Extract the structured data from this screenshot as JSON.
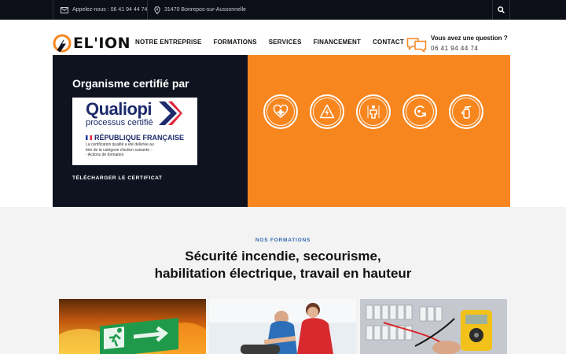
{
  "topbar": {
    "phone_text": "Appelez-nous : 06 41 94 44 74",
    "address_text": "31470 Bonrepos-sur-Aussonnelle"
  },
  "brand": {
    "name": "EL'ION",
    "accent_color": "#f7861f",
    "dark_color": "#0f1320"
  },
  "nav": {
    "items": [
      {
        "label": "NOTRE ENTREPRISE"
      },
      {
        "label": "FORMATIONS"
      },
      {
        "label": "SERVICES"
      },
      {
        "label": "FINANCEMENT"
      },
      {
        "label": "CONTACT"
      }
    ]
  },
  "contact_box": {
    "question": "Vous avez une question ?",
    "phone": "06 41 94 44 74"
  },
  "hero": {
    "title": "Organisme certifié par",
    "certificate": {
      "brand": "Qualiopi",
      "subtitle": "processus certifié",
      "republic": "RÉPUBLIQUE FRANÇAISE",
      "line1": "La certification qualité a été délivrée au",
      "line2": "titre de la catégorie d'action suivante :",
      "line3": "-  Actions de formation"
    },
    "download_label": "TÉLÉCHARGER LE CERTIFICAT",
    "badges": [
      {
        "icon": "first-aid-heart-icon"
      },
      {
        "icon": "electrical-hazard-icon"
      },
      {
        "icon": "fall-protection-icon"
      },
      {
        "icon": "evacuation-icon"
      },
      {
        "icon": "fire-extinguisher-icon"
      }
    ]
  },
  "formations": {
    "kicker": "NOS FORMATIONS",
    "title_line1": "Sécurité incendie, secourisme,",
    "title_line2": "habilitation électrique, travail en hauteur",
    "cards": [
      {
        "image": "emergency-exit-sign-fire-image"
      },
      {
        "image": "first-aid-training-image"
      },
      {
        "image": "electrical-panel-multimeter-image"
      }
    ]
  }
}
